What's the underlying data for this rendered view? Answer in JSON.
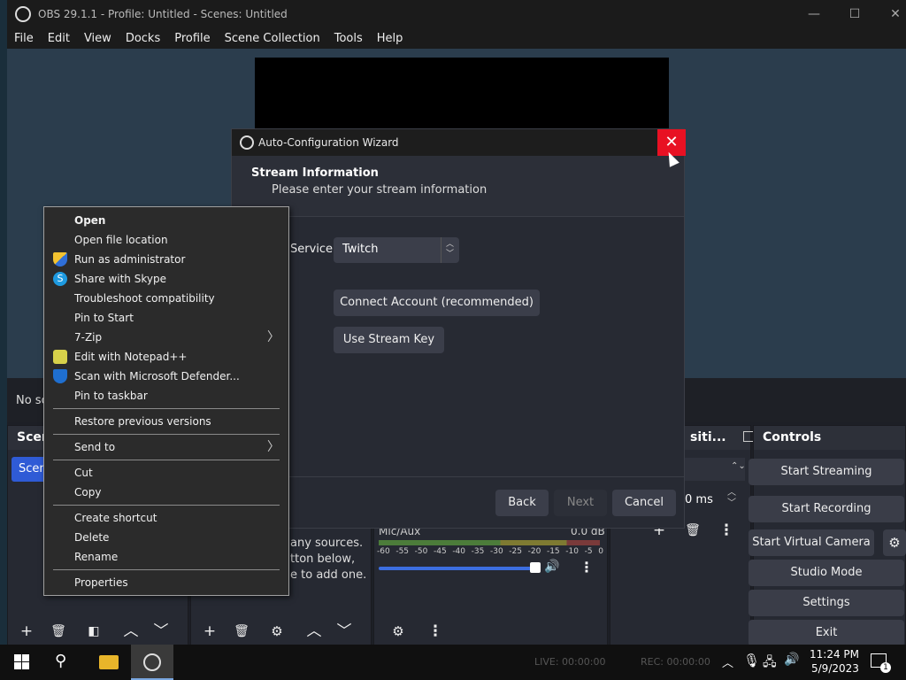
{
  "window": {
    "title": "OBS 29.1.1 - Profile: Untitled - Scenes: Untitled",
    "minimize": "—",
    "maximize": "☐",
    "close": "✕"
  },
  "menu": [
    "File",
    "Edit",
    "View",
    "Docks",
    "Profile",
    "Scene Collection",
    "Tools",
    "Help"
  ],
  "source_bar": {
    "text": "No so"
  },
  "docks": {
    "scenes_title": "Scer",
    "scene_item": "Scen",
    "sources_hint": [
      "any sources.",
      "tton below,",
      "e to add one."
    ],
    "mixer": {
      "label": "Mic/Aux",
      "level": "0.0 dB",
      "ticks": [
        "-60",
        "-55",
        "-50",
        "-45",
        "-40",
        "-35",
        "-30",
        "-25",
        "-20",
        "-15",
        "-10",
        "-5",
        "0"
      ]
    },
    "transitions_title": "siti...",
    "transitions_duration": "0 ms",
    "controls_title": "Controls",
    "controls": [
      "Start Streaming",
      "Start Recording",
      "Start Virtual Camera",
      "Studio Mode",
      "Settings",
      "Exit"
    ]
  },
  "wizard": {
    "title": "Auto-Configuration Wizard",
    "close": "✕",
    "heading": "Stream Information",
    "subheading": "Please enter your stream information",
    "service_label": "Service",
    "service_value": "Twitch",
    "connect_button": "Connect Account (recommended)",
    "stream_key_button": "Use Stream Key",
    "back": "Back",
    "next": "Next",
    "cancel": "Cancel"
  },
  "context_menu": {
    "items": [
      {
        "label": "Open",
        "bold": true
      },
      {
        "label": "Open file location"
      },
      {
        "label": "Run as administrator",
        "icon": "shield-icon"
      },
      {
        "label": "Share with Skype",
        "icon": "skype-icon"
      },
      {
        "label": "Troubleshoot compatibility"
      },
      {
        "label": "Pin to Start"
      },
      {
        "label": "7-Zip",
        "submenu": true
      },
      {
        "label": "Edit with Notepad++",
        "icon": "notepad-icon"
      },
      {
        "label": "Scan with Microsoft Defender...",
        "icon": "defender-icon"
      },
      {
        "label": "Pin to taskbar"
      },
      {
        "label": "Restore previous versions"
      },
      {
        "label": "Send to",
        "submenu": true
      },
      {
        "label": "Cut"
      },
      {
        "label": "Copy"
      },
      {
        "label": "Create shortcut"
      },
      {
        "label": "Delete"
      },
      {
        "label": "Rename"
      },
      {
        "label": "Properties"
      }
    ]
  },
  "taskbar": {
    "status_live": "LIVE: 00:00:00",
    "status_rec": "REC: 00:00:00",
    "time": "11:24 PM",
    "date": "5/9/2023",
    "notification_count": "1"
  }
}
